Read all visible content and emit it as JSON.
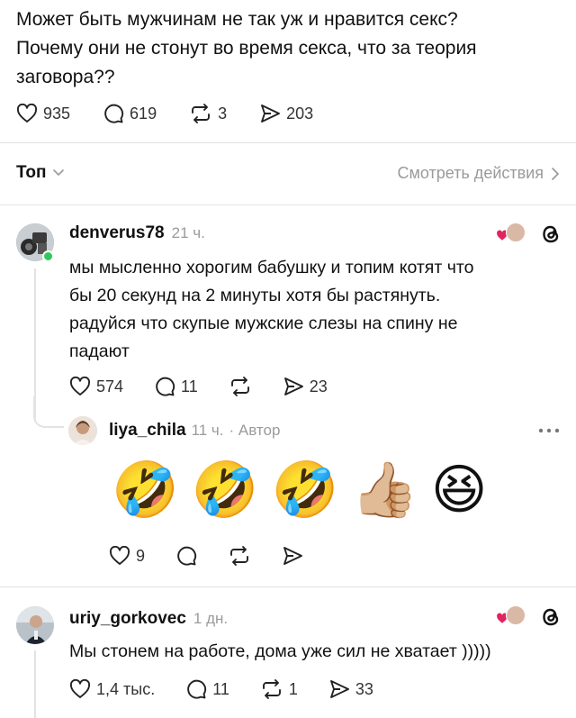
{
  "post": {
    "text_line1": "Может быть мужчинам не так уж и нравится  секс?",
    "text_line2": "Почему они не стонут во время секса, что за теория",
    "text_line3": "заговора??",
    "likes": "935",
    "comments": "619",
    "reposts": "3",
    "shares": "203"
  },
  "sort": {
    "label": "Топ",
    "activity_link": "Смотреть действия"
  },
  "replies": [
    {
      "username": "denverus78",
      "time": "21 ч.",
      "lines": [
        "мы мысленно хорогим бабушку и топим котят что",
        "бы 20 секунд на 2 минуты хотя бы растянуть.",
        "радуйся что скупые мужские слезы на спину не",
        "падают"
      ],
      "likes": "574",
      "comments": "11",
      "shares": "23",
      "reply": {
        "username": "liya_chila",
        "time": "11 ч.",
        "author_badge": "· Автор",
        "emojis": [
          "🤣",
          "🤣",
          "🤣",
          "👍🏼",
          "😆"
        ],
        "likes": "9"
      }
    },
    {
      "username": "uriy_gorkovec",
      "time": "1 дн.",
      "text": "Мы стонем на работе, дома уже сил не хватает )))))",
      "likes": "1,4 тыс.",
      "comments": "11",
      "reposts": "1",
      "shares": "33"
    }
  ],
  "colors": {
    "online": "#2ec95c",
    "muted": "#9b9b9b",
    "divider": "#e2e2e2",
    "heart": "#e0245e"
  },
  "icons": [
    "heart-icon",
    "comment-icon",
    "repost-icon",
    "share-icon",
    "chevron-down-icon",
    "chevron-right-icon",
    "threads-logo-icon",
    "more-icon"
  ]
}
